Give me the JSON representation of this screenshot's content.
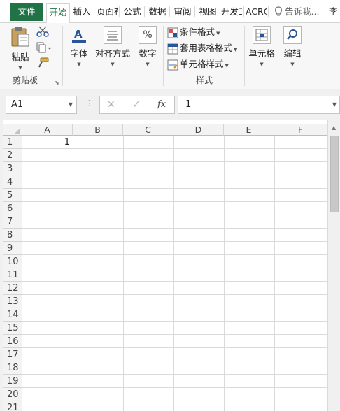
{
  "tabs": [
    {
      "label": "文件"
    },
    {
      "label": "开始"
    },
    {
      "label": "插入"
    },
    {
      "label": "页面布局"
    },
    {
      "label": "公式"
    },
    {
      "label": "数据"
    },
    {
      "label": "审阅"
    },
    {
      "label": "视图"
    },
    {
      "label": "开发工具"
    },
    {
      "label": "ACROBAT"
    },
    {
      "label": "告诉我..."
    },
    {
      "label": "李"
    }
  ],
  "ribbon": {
    "clipboard": {
      "paste": "粘贴",
      "group": "剪贴板"
    },
    "font": {
      "label": "字体"
    },
    "alignment": {
      "label": "对齐方式"
    },
    "number": {
      "label": "数字"
    },
    "styles": {
      "conditional": "条件格式",
      "table": "套用表格格式",
      "cell_styles": "单元格样式",
      "group": "样式"
    },
    "cells": {
      "label": "单元格"
    },
    "editing": {
      "label": "编辑"
    }
  },
  "formula_bar": {
    "name_box": "A1",
    "fx": "fx",
    "value": "1"
  },
  "sheet": {
    "columns": [
      "A",
      "B",
      "C",
      "D",
      "E",
      "F"
    ],
    "rows": [
      "1",
      "2",
      "3",
      "4",
      "5",
      "6",
      "7",
      "8",
      "9",
      "10",
      "11",
      "12",
      "13",
      "14",
      "15",
      "16",
      "17",
      "18",
      "19",
      "20",
      "21"
    ],
    "a1": "1"
  },
  "colors": {
    "file_tab": "#217346",
    "ribbon_bg": "#f7f7f7",
    "icon_accent": "#2a5699"
  }
}
